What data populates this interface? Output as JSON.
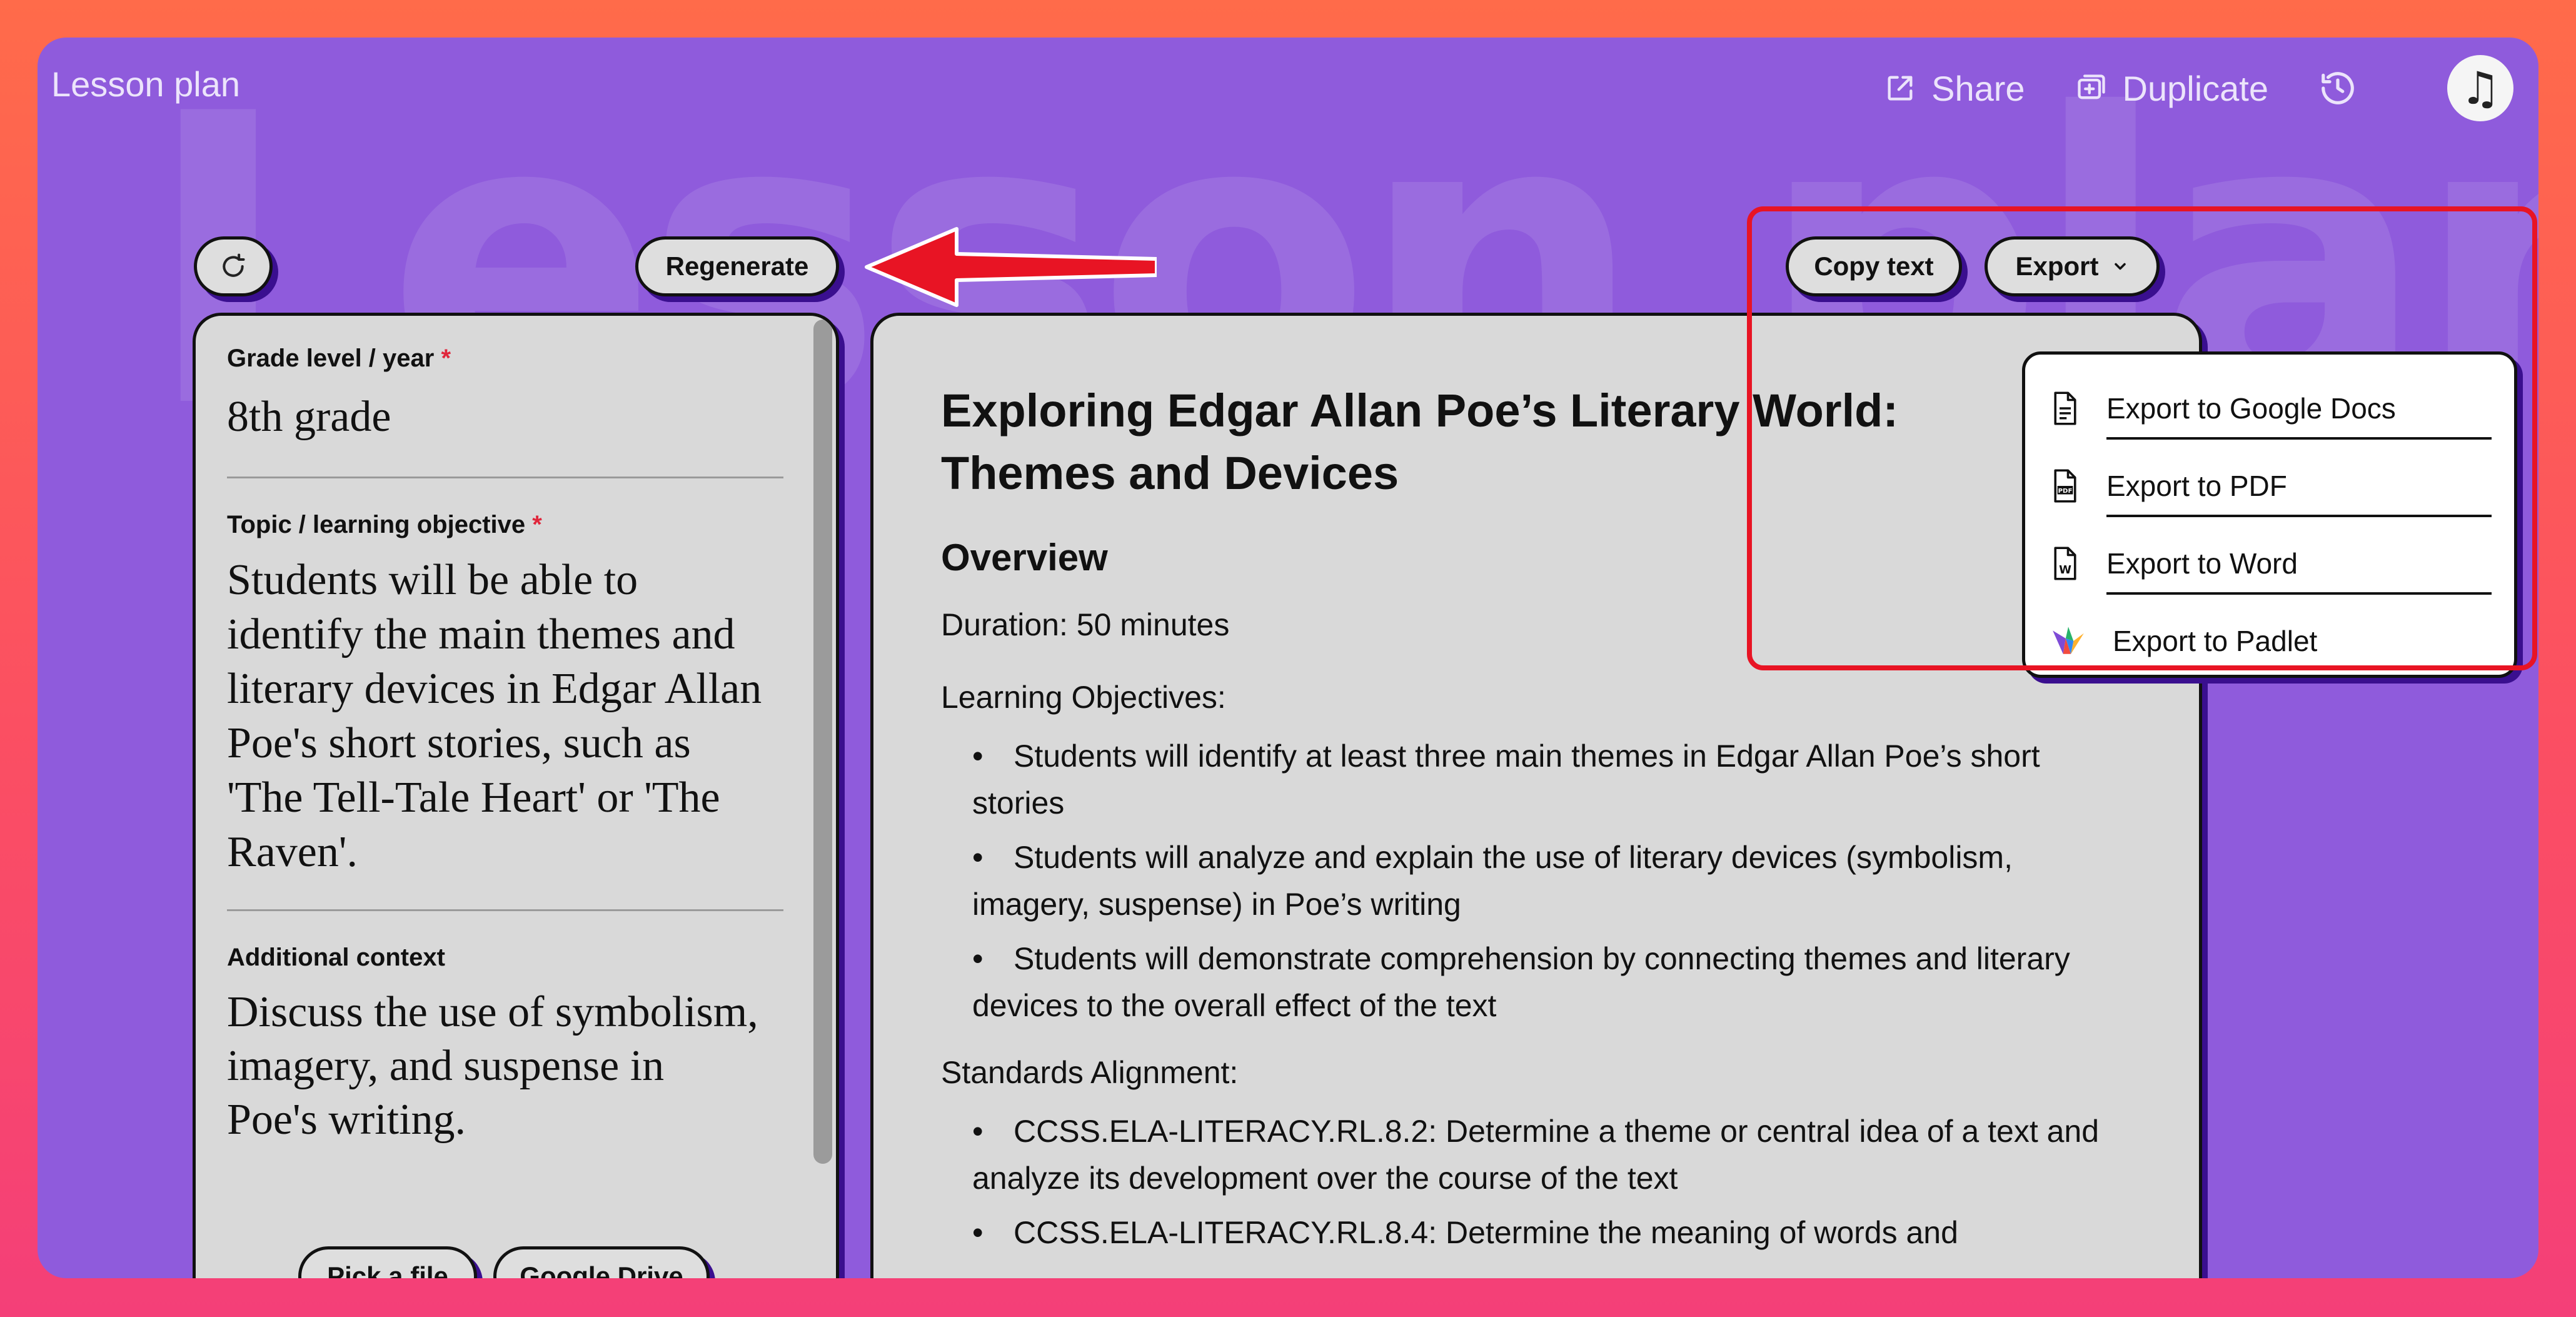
{
  "app": {
    "title": "Lesson plan",
    "watermark": "Lesson plan"
  },
  "header": {
    "share_label": "Share",
    "duplicate_label": "Duplicate",
    "avatar_glyph": "♫"
  },
  "toolbar": {
    "regenerate_label": "Regenerate",
    "copy_text_label": "Copy text",
    "export_label": "Export"
  },
  "form": {
    "grade": {
      "label": "Grade level / year",
      "required_mark": "*",
      "value": "8th grade"
    },
    "topic": {
      "label": "Topic / learning objective",
      "required_mark": "*",
      "value": "Students will be able to identify the main themes and literary devices in Edgar Allan Poe's short stories, such as 'The Tell-Tale Heart' or 'The Raven'."
    },
    "context": {
      "label": "Additional context",
      "value": "Discuss the use of symbolism, imagery, and suspense in Poe's writing."
    },
    "pick_file_label": "Pick a file",
    "google_drive_label": "Google Drive"
  },
  "document": {
    "title": "Exploring Edgar Allan Poe’s Literary World: Themes and Devices",
    "overview_heading": "Overview",
    "duration": "Duration: 50 minutes",
    "objectives_heading": "Learning Objectives:",
    "objectives": [
      "Students will identify at least three main themes in Edgar Allan Poe’s short stories",
      "Students will analyze and explain the use of literary devices (symbolism, imagery, suspense) in Poe’s writing",
      "Students will demonstrate comprehension by connecting themes and literary devices to the overall effect of the text"
    ],
    "standards_heading": "Standards Alignment:",
    "standards": [
      "CCSS.ELA-LITERACY.RL.8.2: Determine a theme or central idea of a text and analyze its development over the course of the text",
      "CCSS.ELA-LITERACY.RL.8.4: Determine the meaning of words and"
    ]
  },
  "export_menu": {
    "items": [
      {
        "label": "Export to Google Docs",
        "icon": "document-icon"
      },
      {
        "label": "Export to PDF",
        "icon": "pdf-icon"
      },
      {
        "label": "Export to Word",
        "icon": "word-icon"
      },
      {
        "label": "Export to Padlet",
        "icon": "padlet-icon"
      }
    ]
  },
  "colors": {
    "app_bg": "#8f5bdc",
    "panel_bg": "#d9d9d9",
    "shadow": "#3a0f8f",
    "annotation_red": "#e81424",
    "required": "#e0263b"
  }
}
